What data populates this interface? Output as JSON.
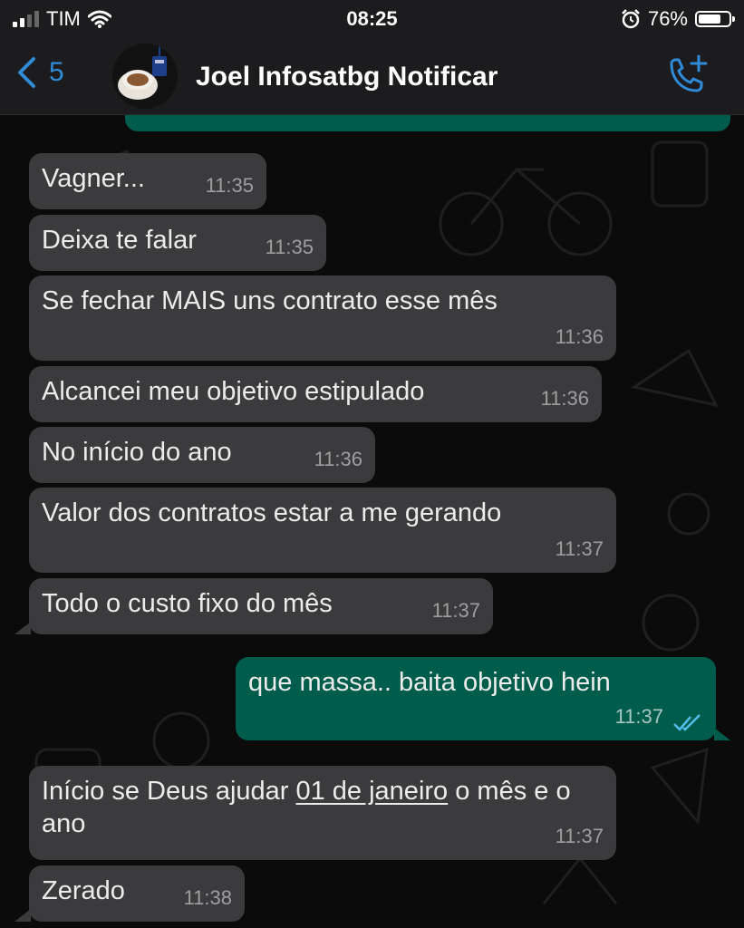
{
  "status_bar": {
    "carrier": "TIM",
    "time": "08:25",
    "battery": "76%",
    "battery_level": 0.76
  },
  "header": {
    "back_count": "5",
    "contact_name": "Joel Infosatbg Notificar"
  },
  "messages": [
    {
      "dir": "in",
      "text": "Vagner...",
      "time": "11:35"
    },
    {
      "dir": "in",
      "text": "Deixa te falar",
      "time": "11:35"
    },
    {
      "dir": "in",
      "text": "Se fechar MAIS uns contrato esse mês",
      "time": "11:36"
    },
    {
      "dir": "in",
      "text": "Alcancei meu objetivo estipulado",
      "time": "11:36"
    },
    {
      "dir": "in",
      "text": "No  início do ano",
      "time": "11:36"
    },
    {
      "dir": "in",
      "text": "Valor dos contratos estar a me gerando",
      "time": "11:37"
    },
    {
      "dir": "in",
      "text": "Todo o custo fixo do mês",
      "time": "11:37"
    },
    {
      "dir": "out",
      "text": "que massa.. baita objetivo hein",
      "time": "11:37",
      "status": "read"
    },
    {
      "dir": "in",
      "text_before": "Início se Deus ajudar ",
      "link": "01 de janeiro",
      "text_after": " o mês e o ano",
      "time": "11:37"
    },
    {
      "dir": "in",
      "text": "Zerado",
      "time": "11:38"
    }
  ],
  "colors": {
    "accent": "#2f8bd8",
    "incoming_bubble": "#3b3b3d",
    "outgoing_bubble": "#005c4b",
    "read_ticks": "#53bdeb"
  }
}
